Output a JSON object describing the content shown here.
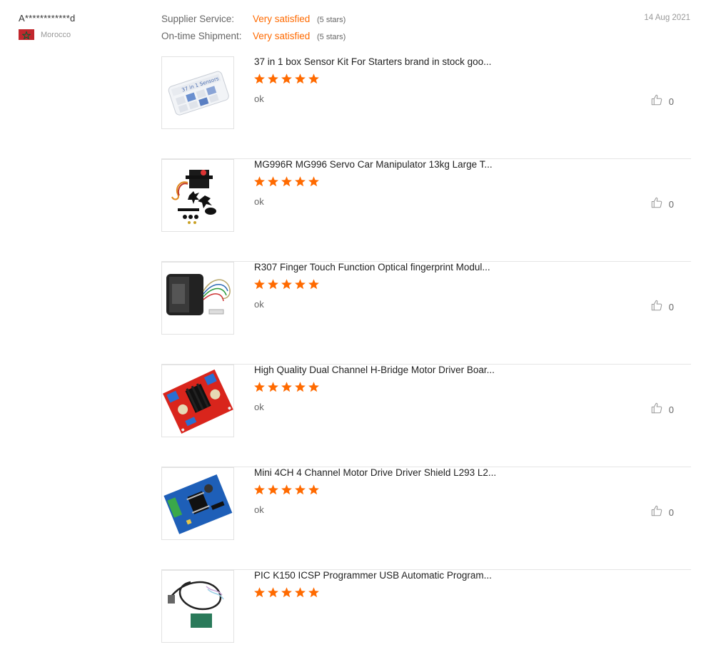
{
  "buyer": {
    "name": "A************d",
    "country": "Morocco",
    "flag_color": "#c1272d"
  },
  "ratings": [
    {
      "label": "Supplier Service:",
      "value": "Very satisfied",
      "stars": "(5 stars)"
    },
    {
      "label": "On-time Shipment:",
      "value": "Very satisfied",
      "stars": "(5 stars)"
    }
  ],
  "date": "14 Aug 2021",
  "accent_color": "#ff6a00",
  "products": [
    {
      "title": "37 in 1 box Sensor Kit For Starters brand in stock goo...",
      "rating": 5,
      "comment": "ok",
      "likes": "0",
      "image": "sensor-kit"
    },
    {
      "title": "MG996R MG996 Servo Car Manipulator 13kg Large T...",
      "rating": 5,
      "comment": "ok",
      "likes": "0",
      "image": "servo"
    },
    {
      "title": "R307 Finger Touch Function Optical fingerprint Modul...",
      "rating": 5,
      "comment": "ok",
      "likes": "0",
      "image": "fingerprint"
    },
    {
      "title": "High Quality Dual Channel H-Bridge Motor Driver Boar...",
      "rating": 5,
      "comment": "ok",
      "likes": "0",
      "image": "red-board"
    },
    {
      "title": "Mini 4CH 4 Channel Motor Drive Driver Shield L293 L2...",
      "rating": 5,
      "comment": "ok",
      "likes": "0",
      "image": "blue-board"
    },
    {
      "title": "PIC K150 ICSP Programmer USB Automatic Program...",
      "rating": 5,
      "comment": "",
      "likes": "",
      "image": "usb-cable"
    }
  ]
}
